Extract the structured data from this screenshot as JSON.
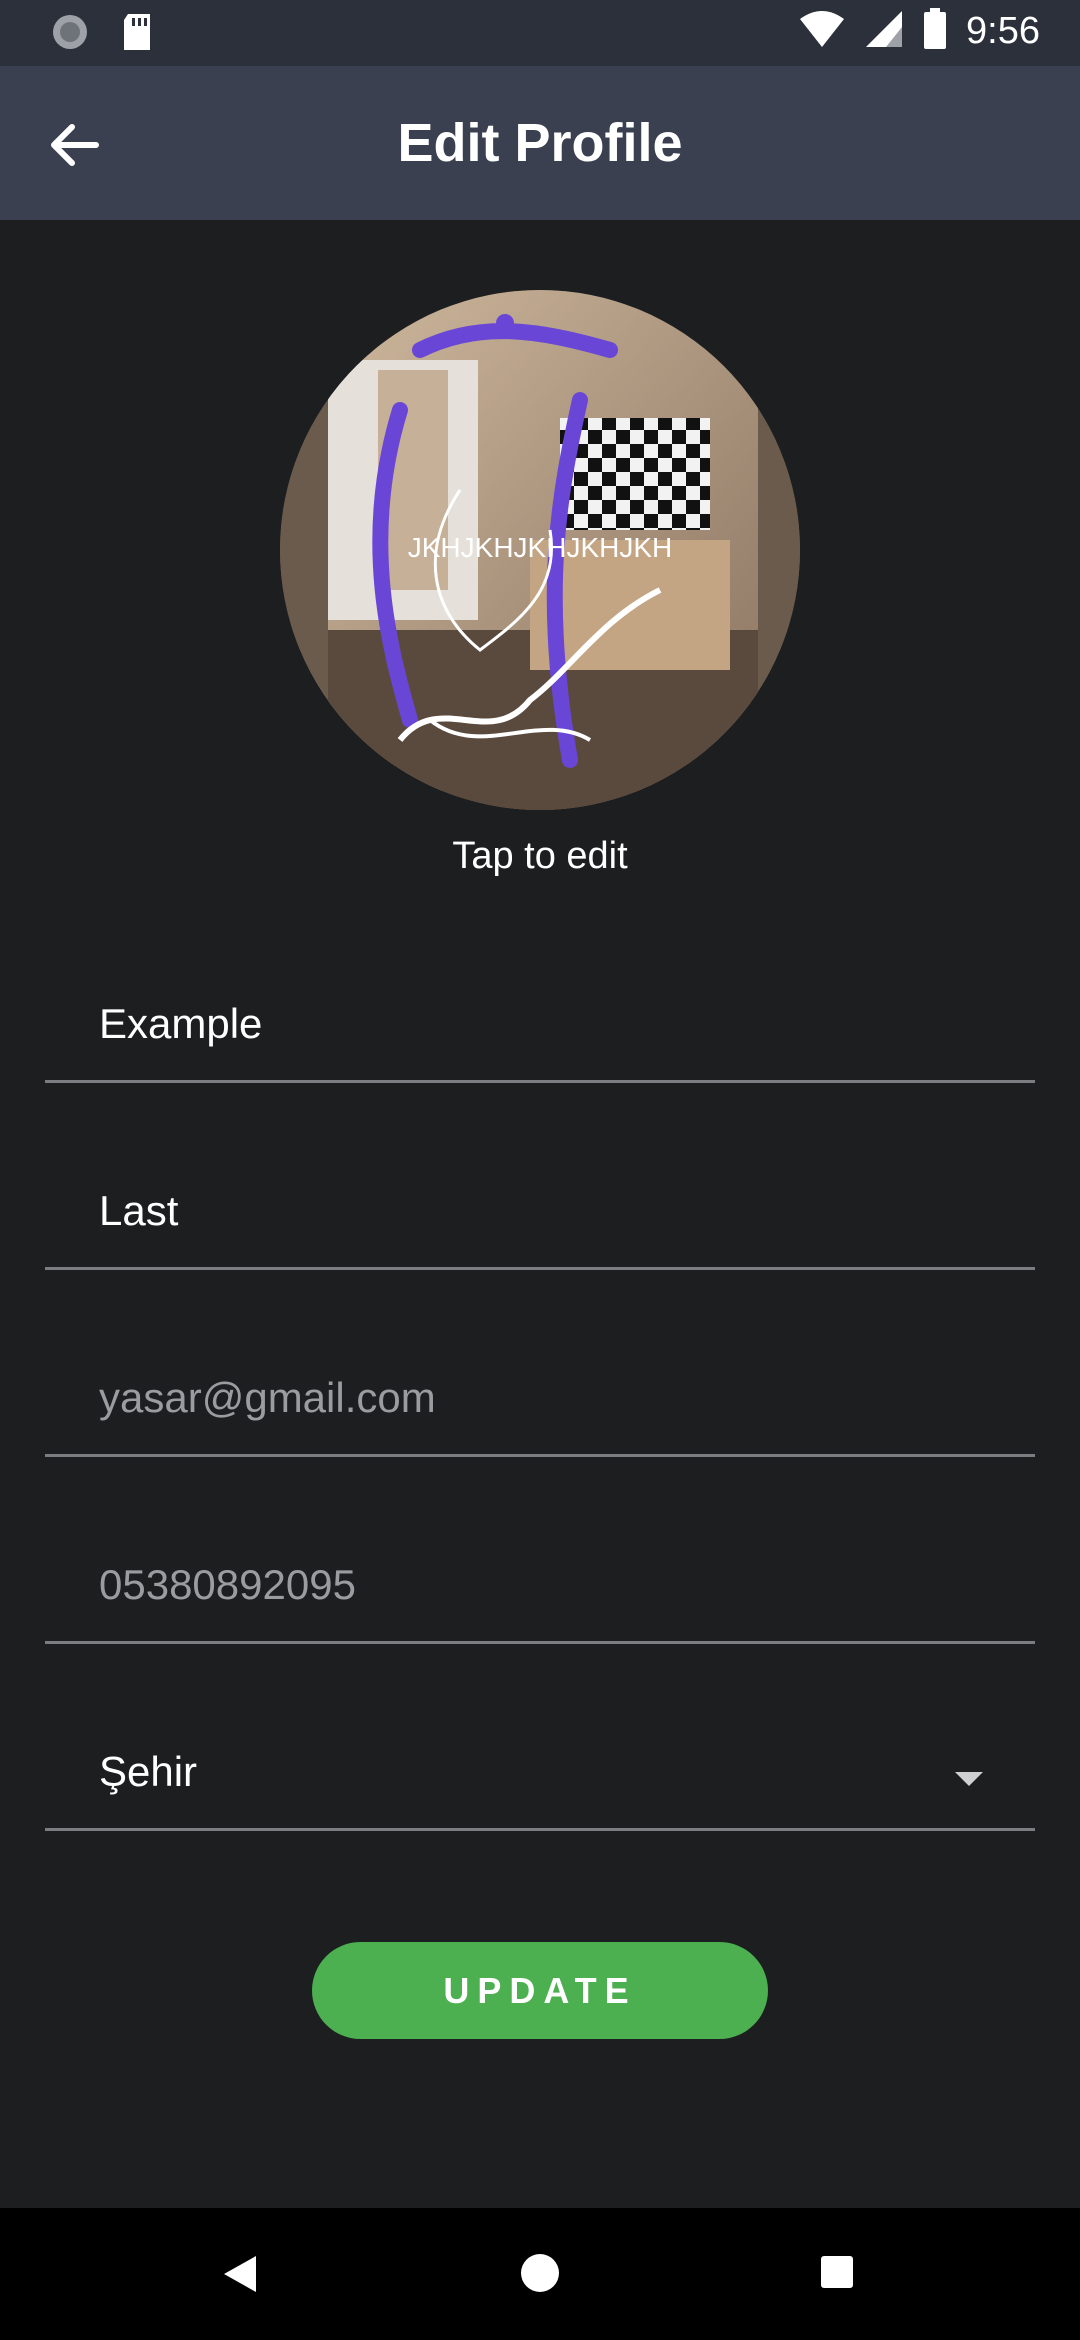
{
  "status_bar": {
    "time": "9:56"
  },
  "app_bar": {
    "title": "Edit Profile"
  },
  "avatar": {
    "overlay_text": "JKHJKHJKHJKHJKH",
    "hint": "Tap to edit"
  },
  "form": {
    "first_name": "Example",
    "last_name": "Last",
    "email": "yasar@gmail.com",
    "phone": "05380892095",
    "city": "Şehir"
  },
  "actions": {
    "update_label": "UPDATE"
  },
  "colors": {
    "accent": "#4caf50",
    "appbar": "#3a4050",
    "background": "#1c1e20",
    "scribble": "#6a46d6"
  }
}
